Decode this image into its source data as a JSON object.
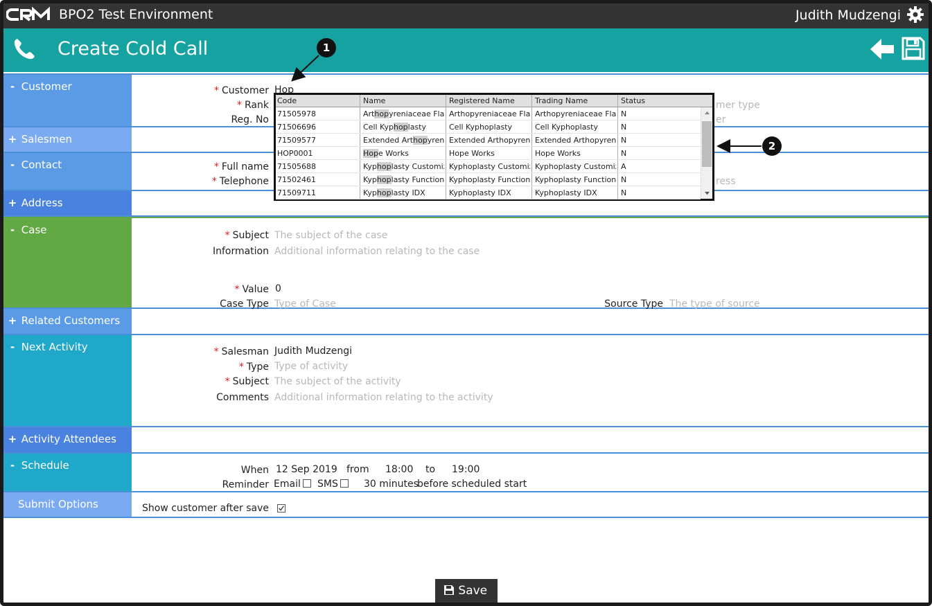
{
  "topbar": {
    "logo_text": "CRM",
    "env_title": "BPO2 Test Environment",
    "user_name": "Judith Mudzengi"
  },
  "header": {
    "title": "Create Cold Call"
  },
  "colors": {
    "topbar": "#333333",
    "header": "#17a2a2",
    "sec_blue": "#5b9be6",
    "sec_blue_light": "#7aaaf0",
    "sec_green": "#62a844",
    "sec_cyan": "#1fa8c9",
    "required": "#d42020"
  },
  "sections": {
    "customer": {
      "toggle": "-",
      "title": "Customer",
      "customer_label": "Customer",
      "customer_value": "Hop",
      "rank_label": "Rank",
      "regno_label": "Reg. No",
      "right_partial_1": "mer type",
      "right_partial_2": "er"
    },
    "salesmen": {
      "toggle": "+",
      "title": "Salesmen"
    },
    "contact": {
      "toggle": "-",
      "title": "Contact",
      "fullname_label": "Full name",
      "telephone_label": "Telephone",
      "right_partial": "ress"
    },
    "address": {
      "toggle": "+",
      "title": "Address"
    },
    "case": {
      "toggle": "-",
      "title": "Case",
      "subject_label": "Subject",
      "subject_placeholder": "The subject of the case",
      "information_label": "Information",
      "information_placeholder": "Additional information relating to the case",
      "value_label": "Value",
      "value_value": "0",
      "casetype_label": "Case Type",
      "casetype_placeholder": "Type of Case",
      "sourcetype_label": "Source Type",
      "sourcetype_placeholder": "The type of source"
    },
    "related_customers": {
      "toggle": "+",
      "title": "Related Customers"
    },
    "next_activity": {
      "toggle": "-",
      "title": "Next Activity",
      "salesman_label": "Salesman",
      "salesman_value": "Judith Mudzengi",
      "type_label": "Type",
      "type_placeholder": "Type of activity",
      "subject_label": "Subject",
      "subject_placeholder": "The subject of the activity",
      "comments_label": "Comments",
      "comments_placeholder": "Additional information relating to the activity"
    },
    "activity_attendees": {
      "toggle": "+",
      "title": "Activity Attendees"
    },
    "schedule": {
      "toggle": "-",
      "title": "Schedule",
      "when_label": "When",
      "date": "12 Sep 2019",
      "from_label": "from",
      "from_time": "18:00",
      "to_label": "to",
      "to_time": "19:00",
      "reminder_label": "Reminder",
      "email_label": "Email",
      "sms_label": "SMS",
      "minutes_value": "30 minutes",
      "before_text": "before scheduled start"
    },
    "submit_options": {
      "title": "Submit Options",
      "show_customer_label": "Show customer after save",
      "show_customer_checked": true
    }
  },
  "save_button": {
    "label": "Save"
  },
  "dropdown": {
    "headers": [
      "Code",
      "Name",
      "Registered Name",
      "Trading Name",
      "Status"
    ],
    "rows": [
      {
        "code": "71505978",
        "name_pre": "Art",
        "name_hl": "hop",
        "name_post": "yreniaceae Flash",
        "registered": "Arthopyreniaceae Flashs",
        "trading": "Arthopyreniaceae Flashs",
        "status": "N"
      },
      {
        "code": "71506696",
        "name_pre": "Cell Kyp",
        "name_hl": "hop",
        "name_post": "lasty",
        "registered": "Cell Kyphoplasty",
        "trading": "Cell Kyphoplasty",
        "status": "N"
      },
      {
        "code": "71509577",
        "name_pre": "Extended Art",
        "name_hl": "hop",
        "name_post": "yrenia",
        "registered": "Extended Arthopyreniac",
        "trading": "Extended Arthopyreniac",
        "status": "N"
      },
      {
        "code": "HOP0001",
        "name_pre": "",
        "name_hl": "Hop",
        "name_post": "e Works",
        "registered": "Hope Works",
        "trading": "Hope Works",
        "status": "N"
      },
      {
        "code": "71505688",
        "name_pre": "Kyp",
        "name_hl": "hop",
        "name_post": "lasty Customiza",
        "registered": "Kyphoplasty Customizat",
        "trading": "Kyphoplasty Customizat",
        "status": "A"
      },
      {
        "code": "71502461",
        "name_pre": "Kyp",
        "name_hl": "hop",
        "name_post": "lasty Function",
        "registered": "Kyphoplasty Function",
        "trading": "Kyphoplasty Function",
        "status": "N"
      },
      {
        "code": "71509711",
        "name_pre": "Kyp",
        "name_hl": "hop",
        "name_post": "lasty IDX",
        "registered": "Kyphoplasty IDX",
        "trading": "Kyphoplasty IDX",
        "status": "N"
      }
    ]
  },
  "callouts": [
    "1",
    "2"
  ]
}
